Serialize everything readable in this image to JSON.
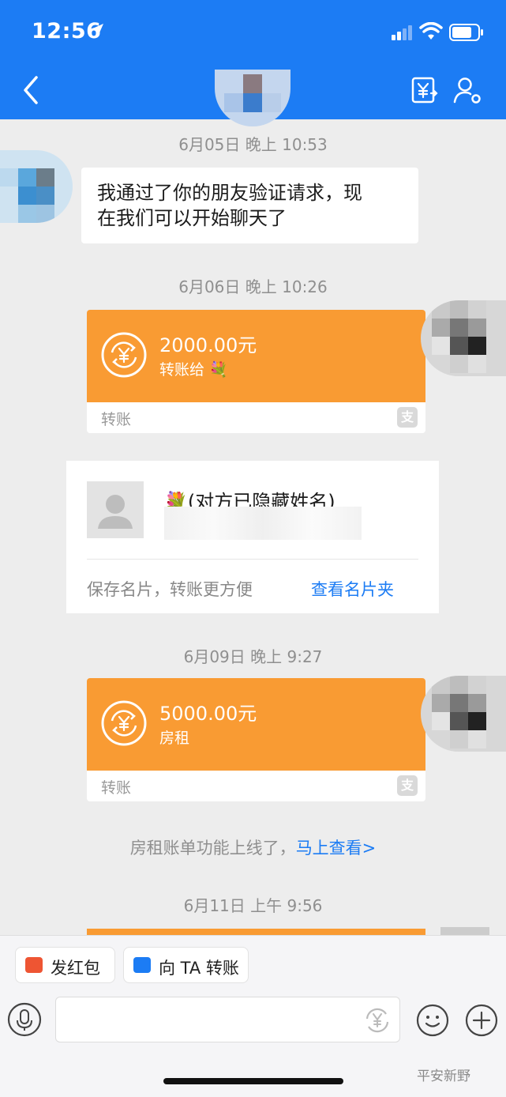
{
  "status_bar": {
    "time": "12:56"
  },
  "chat": {
    "messages": [
      {
        "timestamp": "6月05日 晚上 10:53",
        "text_line1": "我通过了你的朋友验证请求，现",
        "text_line2": "在我们可以开始聊天了"
      },
      {
        "timestamp": "6月06日 晚上 10:26",
        "amount": "2000.00元",
        "note": "转账给",
        "footer": "转账"
      },
      {
        "namecard": {
          "name": "(对方已隐藏姓名)",
          "save_text": "保存名片，转账更方便",
          "view_link": "查看名片夹"
        }
      },
      {
        "timestamp": "6月09日 晚上 9:27",
        "amount": "5000.00元",
        "note": "房租",
        "footer": "转账"
      },
      {
        "system": "房租账单功能上线了，",
        "system_link": "马上查看>"
      },
      {
        "timestamp": "6月11日 上午 9:56"
      }
    ]
  },
  "bottom": {
    "red_packet_label": "发红包",
    "transfer_label": "向 TA 转账",
    "watermark": "平安新野"
  },
  "colors": {
    "header_blue": "#1c7cf4",
    "transfer_orange": "#f99b33",
    "link_blue": "#1c7cf4"
  }
}
